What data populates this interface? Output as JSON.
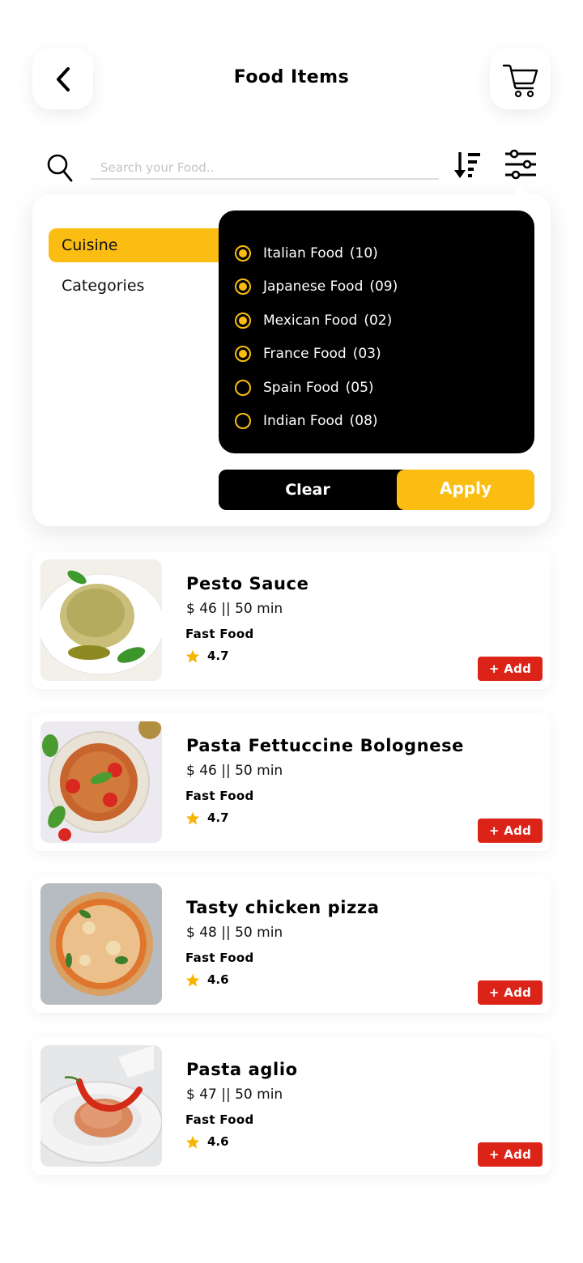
{
  "header": {
    "title": "Food Items",
    "back_icon": "chevron-left-icon",
    "cart_icon": "shopping-cart-icon"
  },
  "search": {
    "placeholder": "Search your Food..",
    "value": "",
    "search_icon": "search-icon",
    "sort_icon": "sort-descending-icon",
    "filter_icon": "sliders-icon"
  },
  "filter": {
    "tabs": [
      {
        "label": "Cuisine",
        "active": true
      },
      {
        "label": "Categories",
        "active": false
      }
    ],
    "options": [
      {
        "label": "Italian Food",
        "count": "(10)",
        "checked": true
      },
      {
        "label": "Japanese Food",
        "count": "(09)",
        "checked": true
      },
      {
        "label": "Mexican Food",
        "count": "(02)",
        "checked": true
      },
      {
        "label": "France Food",
        "count": "(03)",
        "checked": true
      },
      {
        "label": "Spain Food",
        "count": "(05)",
        "checked": false
      },
      {
        "label": "Indian Food",
        "count": "(08)",
        "checked": false
      }
    ],
    "clear_label": "Clear",
    "apply_label": "Apply"
  },
  "items": [
    {
      "name": "Pesto Sauce",
      "price": "$ 46 || 50 min",
      "category": "Fast Food",
      "rating": "4.7",
      "add_label": "+ Add",
      "image": "pesto-pasta"
    },
    {
      "name": "Pasta Fettuccine Bolognese",
      "price": "$ 46 || 50 min",
      "category": "Fast Food",
      "rating": "4.7",
      "add_label": "+ Add",
      "image": "bolognese-pasta"
    },
    {
      "name": "Tasty chicken pizza",
      "price": "$ 48 || 50 min",
      "category": "Fast Food",
      "rating": "4.6",
      "add_label": "+ Add",
      "image": "chicken-pizza"
    },
    {
      "name": "Pasta aglio",
      "price": "$ 47 || 50 min",
      "category": "Fast Food",
      "rating": "4.6",
      "add_label": "+ Add",
      "image": "pasta-aglio"
    }
  ],
  "colors": {
    "accent": "#fbbd12",
    "add_button": "#dc2318",
    "panel_dark": "#000000",
    "star": "#f7b500"
  }
}
